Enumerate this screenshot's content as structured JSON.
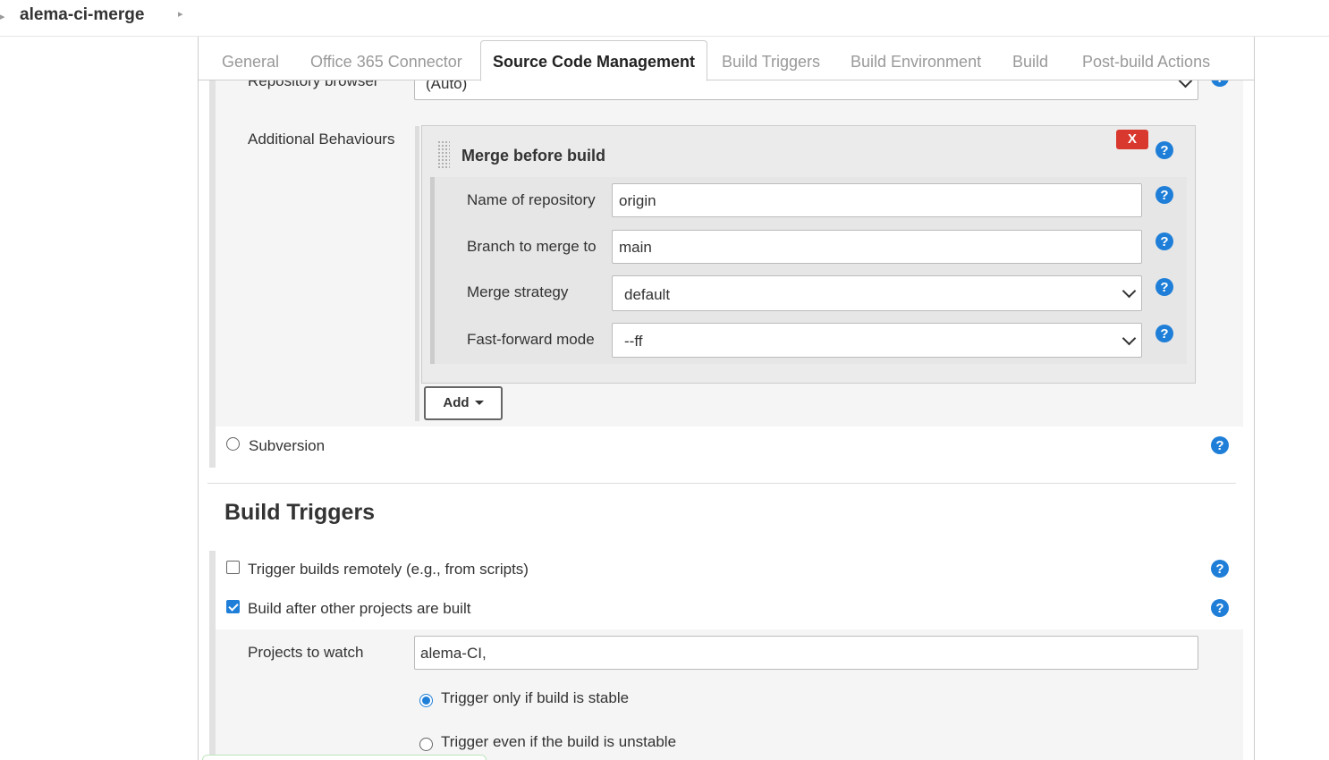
{
  "breadcrumb": {
    "title": "alema-ci-merge"
  },
  "tabs": [
    {
      "label": "General"
    },
    {
      "label": "Office 365 Connector"
    },
    {
      "label": "Source Code Management"
    },
    {
      "label": "Build Triggers"
    },
    {
      "label": "Build Environment"
    },
    {
      "label": "Build"
    },
    {
      "label": "Post-build Actions"
    }
  ],
  "scm": {
    "repo_browser_label": "Repository browser",
    "repo_browser_value": "(Auto)",
    "additional_behaviours_label": "Additional Behaviours",
    "merge": {
      "title": "Merge before build",
      "delete_label": "X",
      "repo_name_label": "Name of repository",
      "repo_name_value": "origin",
      "branch_label": "Branch to merge to",
      "branch_value": "main",
      "strategy_label": "Merge strategy",
      "strategy_value": "default",
      "ff_label": "Fast-forward mode",
      "ff_value": "--ff"
    },
    "add_label": "Add",
    "subversion_label": "Subversion"
  },
  "build_triggers": {
    "heading": "Build Triggers",
    "remote_label": "Trigger builds remotely (e.g., from scripts)",
    "remote_checked": false,
    "after_label": "Build after other projects are built",
    "after_checked": true,
    "projects_label": "Projects to watch",
    "projects_value": "alema-CI,",
    "stable_label": "Trigger only if build is stable",
    "unstable_label": "Trigger even if the build is unstable"
  },
  "help_glyph": "?",
  "colors": {
    "help": "#1f7fd8",
    "delete": "#d9382f"
  }
}
